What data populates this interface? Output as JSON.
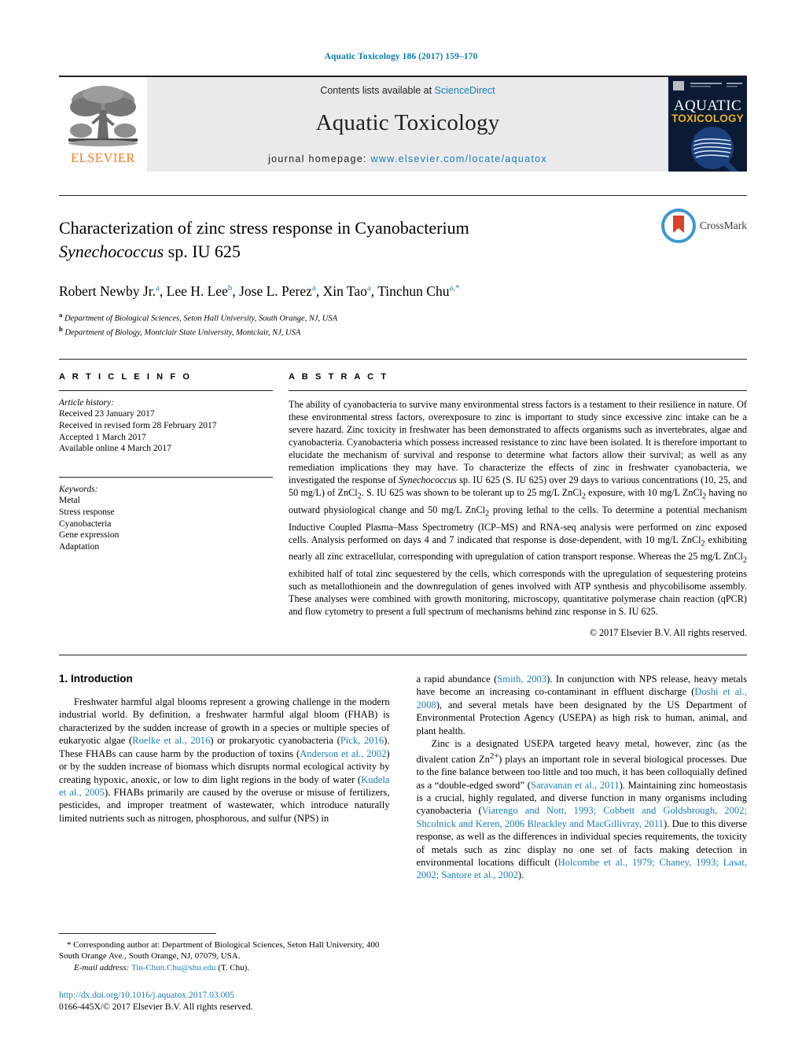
{
  "running_head": "Aquatic Toxicology 186 (2017) 159–170",
  "masthead": {
    "elsevier_wordmark": "ELSEVIER",
    "contents_prefix": "Contents lists available at ",
    "contents_link": "ScienceDirect",
    "journal_name": "Aquatic Toxicology",
    "homepage_label": "journal homepage: ",
    "homepage_url": "www.elsevier.com/locate/aquatox",
    "cover": {
      "line1": "AQUATIC",
      "line2": "TOXICOLOGY"
    },
    "colors": {
      "link_blue": "#1a7eb8",
      "elsevier_orange": "#f47c20",
      "panel_grey": "#eaeaec",
      "cover_navy": "#0b1b33",
      "cover_gold": "#e8b021"
    }
  },
  "article": {
    "title_line1": "Characterization of zinc stress response in Cyanobacterium",
    "title_line2_italic": "Synechococcus",
    "title_line2_rest": " sp. IU 625",
    "authors": [
      {
        "name": "Robert Newby Jr.",
        "marks": "a"
      },
      {
        "name": "Lee H. Lee",
        "marks": "b"
      },
      {
        "name": "Jose L. Perez",
        "marks": "a"
      },
      {
        "name": "Xin Tao",
        "marks": "a"
      },
      {
        "name": "Tinchun Chu",
        "marks": "a,*"
      }
    ],
    "affiliations": [
      {
        "mark": "a",
        "text": "Department of Biological Sciences, Seton Hall University, South Orange, NJ, USA"
      },
      {
        "mark": "b",
        "text": "Department of Biology, Montclair State University, Montclair, NJ, USA"
      }
    ],
    "crossmark_label": "CrossMark"
  },
  "info": {
    "heading": "A R T I C L E   I N F O",
    "history_label": "Article history:",
    "history": [
      "Received 23 January 2017",
      "Received in revised form 28 February 2017",
      "Accepted 1 March 2017",
      "Available online 4 March 2017"
    ],
    "keywords_label": "Keywords:",
    "keywords": [
      "Metal",
      "Stress response",
      "Cyanobacteria",
      "Gene expression",
      "Adaptation"
    ]
  },
  "abstract": {
    "heading": "A B S T R A C T",
    "part1": "The ability of cyanobacteria to survive many environmental stress factors is a testament to their resilience in nature. Of these environmental stress factors, overexposure to zinc is important to study since excessive zinc intake can be a severe hazard. Zinc toxicity in freshwater has been demonstrated to affects organisms such as invertebrates, algae and cyanobacteria. Cyanobacteria which possess increased resistance to zinc have been isolated. It is therefore important to elucidate the mechanism of survival and response to determine what factors allow their survival; as well as any remediation implications they may have. To characterize the effects of zinc in freshwater cyanobacteria, we investigated the response of ",
    "species1": "Synechococcus",
    "part2": " sp. IU 625 (S. IU 625) over 29 days to various concentrations (10, 25, and 50 mg/L) of ZnCl",
    "sub1": "2",
    "part3": ". S. IU 625 was shown to be tolerant up to 25 mg/L ZnCl",
    "sub2": "2",
    "part4": " exposure, with 10 mg/L ZnCl",
    "sub3": "2",
    "part5": " having no outward physiological change and 50 mg/L ZnCl",
    "sub4": "2",
    "part6": " proving lethal to the cells. To determine a potential mechanism Inductive Coupled Plasma–Mass Spectrometry (ICP–MS) and RNA-seq analysis were performed on zinc exposed cells. Analysis performed on days 4 and 7 indicated that response is dose-dependent, with 10 mg/L ZnCl",
    "sub5": "2",
    "part7": " exhibiting nearly all zinc extracellular, corresponding with upregulation of cation transport response. Whereas the 25 mg/L ZnCl",
    "sub6": "2",
    "part8": " exhibited half of total zinc sequestered by the cells, which corresponds with the upregulation of sequestering proteins such as metallothionein and the downregulation of genes involved with ATP synthesis and phycobilisome assembly. These analyses were combined with growth monitoring, microscopy, quantitative polymerase chain reaction (qPCR) and flow cytometry to present a full spectrum of mechanisms behind zinc response in S. IU 625.",
    "copyright": "© 2017 Elsevier B.V. All rights reserved."
  },
  "introduction": {
    "heading": "1.  Introduction",
    "left_part1": "Freshwater harmful algal blooms represent a growing challenge in the modern industrial world. By definition, a freshwater harmful algal bloom (FHAB) is characterized by the sudden increase of growth in a species or multiple species of eukaryotic algae (",
    "cite1": "Roelke et al., 2016",
    "left_part2": ") or prokaryotic cyanobacteria (",
    "cite2": "Pick, 2016",
    "left_part3": "). These FHABs can cause harm by the production of toxins (",
    "cite3": "Anderson et al., 2002",
    "left_part4": ") or by the sudden increase of biomass which disrupts normal ecological activity by creating hypoxic, anoxic, or low to dim light regions in the body of water (",
    "cite4": "Kudela et al., 2005",
    "left_part5": "). FHABs primarily are caused by the overuse or misuse of fertilizers, pesticides, and improper treatment of wastewater, which introduce naturally limited nutrients such as nitrogen, phosphorous, and sulfur (NPS) in",
    "right_part1": "a rapid abundance (",
    "cite5": "Smith, 2003",
    "right_part2": "). In conjunction with NPS release, heavy metals have become an increasing co-contaminant in effluent discharge (",
    "cite6": "Doshi et al., 2008",
    "right_part3": "), and several metals have been designated by the US Department of Environmental Protection Agency (USEPA) as high risk to human, animal, and plant health.",
    "right_para2_part1": "Zinc is a designated USEPA targeted heavy metal, however, zinc (as the divalent cation Zn",
    "zn_sup": "2+",
    "right_para2_part2": ") plays an important role in several biological processes. Due to the fine balance between too little and too much, it has been colloquially defined as a “double-edged sword” (",
    "cite7": "Saravanan et al., 2011",
    "right_para2_part3": "). Maintaining zinc homeostasis is a crucial, highly regulated, and diverse function in many organisms including cyanobacteria (",
    "cite8": "Viarengo and Nott, 1993; Cobbett and Goldsbrough, 2002; Shcolnick and Keren, 2006 Bleackley and MacGillivray, 2011",
    "right_para2_part4": "). Due to this diverse response, as well as the differences in individual species requirements, the toxicity of metals such as zinc display no one set of facts making detection in environmental locations difficult (",
    "cite9": "Holcombe et al., 1979; Chaney, 1993; Lasat, 2002; Santore et al., 2002",
    "right_para2_part5": ")."
  },
  "footnotes": {
    "corresponding": "*  Corresponding author at: Department of Biological Sciences, Seton Hall University, 400 South Orange Ave., South Orange, NJ, 07079, USA.",
    "email_label": "E-mail address: ",
    "email": "Tin-Chun.Chu@shu.edu",
    "email_suffix": " (T. Chu).",
    "doi": "http://dx.doi.org/10.1016/j.aquatox.2017.03.005",
    "issn_line": "0166-445X/© 2017 Elsevier B.V. All rights reserved."
  }
}
